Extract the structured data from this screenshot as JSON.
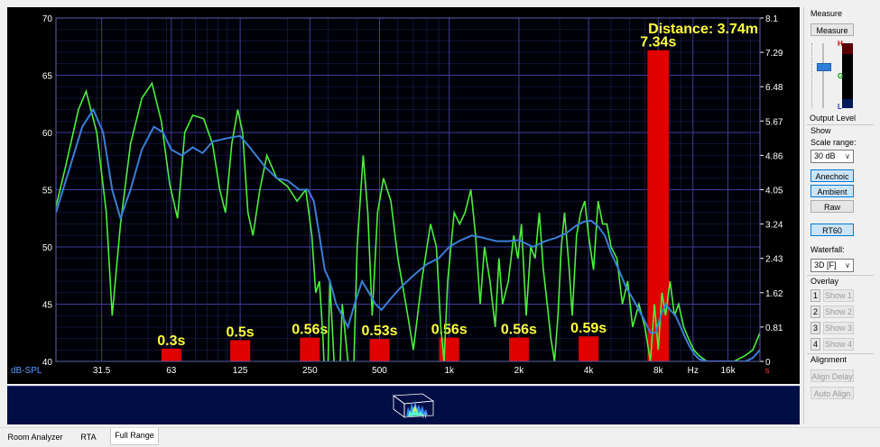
{
  "chart_data": {
    "type": "line",
    "y_axis_label": "dB-SPL",
    "y_left": {
      "min": 40,
      "max": 70,
      "ticks": [
        40,
        45,
        50,
        55,
        60,
        65,
        70
      ]
    },
    "y_right_ticks": [
      "0",
      "0.81",
      "1.62",
      "2.43",
      "3.24",
      "4.05",
      "4.86",
      "5.67",
      "6.48",
      "7.29",
      "8.1"
    ],
    "x_ticks": [
      {
        "label": "31.5",
        "f": 31.5
      },
      {
        "label": "63",
        "f": 63
      },
      {
        "label": "125",
        "f": 125
      },
      {
        "label": "250",
        "f": 250
      },
      {
        "label": "500",
        "f": 500
      },
      {
        "label": "1k",
        "f": 1000
      },
      {
        "label": "2k",
        "f": 2000
      },
      {
        "label": "4k",
        "f": 4000
      },
      {
        "label": "8k",
        "f": 8000
      },
      {
        "label": "Hz",
        "f": 11300
      },
      {
        "label": "16k",
        "f": 16000
      }
    ],
    "x_marker": "s",
    "x_range": [
      20,
      22000
    ],
    "series": [
      {
        "color": "#4cf03c",
        "points": [
          [
            20,
            53.5
          ],
          [
            22,
            57
          ],
          [
            25,
            62
          ],
          [
            27,
            63.6
          ],
          [
            30,
            60
          ],
          [
            33,
            53
          ],
          [
            35,
            44
          ],
          [
            38,
            52
          ],
          [
            42,
            59
          ],
          [
            47,
            63
          ],
          [
            52,
            64.3
          ],
          [
            57,
            61
          ],
          [
            62,
            55.5
          ],
          [
            67,
            52.5
          ],
          [
            72,
            60
          ],
          [
            78,
            61.5
          ],
          [
            87,
            61.2
          ],
          [
            95,
            59
          ],
          [
            102,
            55
          ],
          [
            108,
            53
          ],
          [
            115,
            59
          ],
          [
            122,
            62
          ],
          [
            128,
            60
          ],
          [
            135,
            53
          ],
          [
            142,
            51
          ],
          [
            152,
            55
          ],
          [
            163,
            58
          ],
          [
            180,
            56
          ],
          [
            200,
            55.3
          ],
          [
            220,
            54
          ],
          [
            240,
            55
          ],
          [
            255,
            51
          ],
          [
            265,
            46
          ],
          [
            275,
            47
          ],
          [
            285,
            42
          ],
          [
            295,
            33
          ],
          [
            305,
            47
          ],
          [
            318,
            40
          ],
          [
            330,
            30
          ],
          [
            345,
            45
          ],
          [
            365,
            40
          ],
          [
            380,
            33
          ],
          [
            400,
            50
          ],
          [
            425,
            58
          ],
          [
            445,
            53
          ],
          [
            465,
            44
          ],
          [
            490,
            53
          ],
          [
            520,
            56
          ],
          [
            560,
            54
          ],
          [
            600,
            49
          ],
          [
            650,
            45
          ],
          [
            700,
            41
          ],
          [
            760,
            47
          ],
          [
            830,
            52
          ],
          [
            880,
            50
          ],
          [
            920,
            43
          ],
          [
            950,
            40
          ],
          [
            985,
            47
          ],
          [
            1050,
            53
          ],
          [
            1110,
            52
          ],
          [
            1170,
            53
          ],
          [
            1240,
            55
          ],
          [
            1300,
            51
          ],
          [
            1360,
            45
          ],
          [
            1420,
            50
          ],
          [
            1500,
            47
          ],
          [
            1580,
            43
          ],
          [
            1640,
            49
          ],
          [
            1700,
            45
          ],
          [
            1800,
            47
          ],
          [
            1900,
            51
          ],
          [
            1980,
            49
          ],
          [
            2050,
            52
          ],
          [
            2150,
            44
          ],
          [
            2250,
            50
          ],
          [
            2350,
            49
          ],
          [
            2450,
            53
          ],
          [
            2550,
            48
          ],
          [
            2650,
            45
          ],
          [
            2750,
            42
          ],
          [
            2850,
            40
          ],
          [
            2950,
            44
          ],
          [
            3050,
            50
          ],
          [
            3150,
            53
          ],
          [
            3300,
            48
          ],
          [
            3400,
            44
          ],
          [
            3550,
            51
          ],
          [
            3700,
            53
          ],
          [
            3850,
            54
          ],
          [
            4000,
            51
          ],
          [
            4200,
            48
          ],
          [
            4400,
            54
          ],
          [
            4600,
            52
          ],
          [
            4800,
            52
          ],
          [
            5000,
            50
          ],
          [
            5300,
            49
          ],
          [
            5600,
            45
          ],
          [
            5900,
            47
          ],
          [
            6200,
            43
          ],
          [
            6600,
            45
          ],
          [
            7000,
            43
          ],
          [
            7400,
            40
          ],
          [
            7700,
            45
          ],
          [
            8000,
            41
          ],
          [
            8300,
            46
          ],
          [
            8600,
            44
          ],
          [
            9000,
            47
          ],
          [
            9400,
            44
          ],
          [
            9800,
            45
          ],
          [
            10300,
            43
          ],
          [
            10800,
            42
          ],
          [
            11400,
            41
          ],
          [
            12000,
            40.5
          ],
          [
            13000,
            40
          ],
          [
            15000,
            40
          ],
          [
            17000,
            40
          ],
          [
            19000,
            40.5
          ],
          [
            20500,
            41
          ],
          [
            22000,
            42.5
          ]
        ]
      },
      {
        "color": "#3a7fd8",
        "points": [
          [
            20,
            53
          ],
          [
            23,
            57
          ],
          [
            26,
            60.5
          ],
          [
            29,
            62
          ],
          [
            32,
            60
          ],
          [
            35,
            55
          ],
          [
            38,
            52.5
          ],
          [
            42,
            55
          ],
          [
            47,
            58.5
          ],
          [
            53,
            60.5
          ],
          [
            58,
            60
          ],
          [
            63,
            58.5
          ],
          [
            70,
            58
          ],
          [
            78,
            58.7
          ],
          [
            86,
            58.2
          ],
          [
            95,
            59.2
          ],
          [
            110,
            59.5
          ],
          [
            125,
            59.7
          ],
          [
            140,
            58.5
          ],
          [
            160,
            57
          ],
          [
            180,
            56
          ],
          [
            200,
            55.8
          ],
          [
            225,
            55
          ],
          [
            245,
            55
          ],
          [
            260,
            54
          ],
          [
            275,
            51
          ],
          [
            290,
            48
          ],
          [
            305,
            47
          ],
          [
            325,
            45
          ],
          [
            345,
            44
          ],
          [
            365,
            43
          ],
          [
            390,
            45
          ],
          [
            420,
            47
          ],
          [
            450,
            46
          ],
          [
            480,
            45
          ],
          [
            510,
            44.5
          ],
          [
            560,
            45.5
          ],
          [
            620,
            46.5
          ],
          [
            700,
            47.5
          ],
          [
            800,
            48.5
          ],
          [
            900,
            49
          ],
          [
            1000,
            50
          ],
          [
            1100,
            50.5
          ],
          [
            1250,
            51
          ],
          [
            1400,
            50.8
          ],
          [
            1600,
            50.5
          ],
          [
            1800,
            50.5
          ],
          [
            2000,
            50.6
          ],
          [
            2300,
            50
          ],
          [
            2600,
            50.5
          ],
          [
            2900,
            50.8
          ],
          [
            3200,
            51.2
          ],
          [
            3500,
            51.8
          ],
          [
            3800,
            52.2
          ],
          [
            4100,
            52.3
          ],
          [
            4400,
            51.8
          ],
          [
            4700,
            51
          ],
          [
            5000,
            49.5
          ],
          [
            5400,
            48
          ],
          [
            5800,
            46.5
          ],
          [
            6200,
            45.5
          ],
          [
            6600,
            44.5
          ],
          [
            7000,
            43.5
          ],
          [
            7400,
            42.5
          ],
          [
            7800,
            42.5
          ],
          [
            8200,
            44
          ],
          [
            8600,
            45
          ],
          [
            9000,
            44.5
          ],
          [
            9500,
            44
          ],
          [
            10000,
            43
          ],
          [
            10500,
            42
          ],
          [
            11000,
            41.2
          ],
          [
            11500,
            40.6
          ],
          [
            12000,
            40.2
          ],
          [
            13000,
            40
          ],
          [
            17000,
            40
          ],
          [
            19000,
            40
          ],
          [
            20500,
            40.3
          ],
          [
            22000,
            41
          ]
        ]
      }
    ],
    "rt60_bars": [
      {
        "f": 63,
        "value": 0.3,
        "label": "0.3s"
      },
      {
        "f": 125,
        "value": 0.5,
        "label": "0.5s"
      },
      {
        "f": 250,
        "value": 0.56,
        "label": "0.56s"
      },
      {
        "f": 500,
        "value": 0.53,
        "label": "0.53s"
      },
      {
        "f": 1000,
        "value": 0.56,
        "label": "0.56s"
      },
      {
        "f": 2000,
        "value": 0.56,
        "label": "0.56s"
      },
      {
        "f": 4000,
        "value": 0.59,
        "label": "0.59s"
      },
      {
        "f": 8000,
        "value": 7.34,
        "label": "7.34s"
      }
    ],
    "distance_label": "Distance: 3.74m"
  },
  "panel": {
    "measure_title": "Measure",
    "measure_button": "Measure",
    "meter": {
      "h": "H",
      "g": "G",
      "l": "L"
    },
    "output_level": "Output Level",
    "show": "Show",
    "scale_range": "Scale range:",
    "scale_value": "30 dB",
    "anechoic": "Anechoic",
    "ambient": "Ambient",
    "raw": "Raw",
    "rt60": "RT60",
    "waterfall": "Waterfall:",
    "waterfall_value": "3D [F]",
    "overlay": "Overlay",
    "overlays": [
      {
        "num": "1",
        "label": "Show 1"
      },
      {
        "num": "2",
        "label": "Show 2"
      },
      {
        "num": "3",
        "label": "Show 3"
      },
      {
        "num": "4",
        "label": "Show 4"
      }
    ],
    "alignment": "Alignment",
    "align_delay": "Align Delay",
    "auto_align": "Auto Align"
  },
  "tabs": [
    "Room Analyzer",
    "RTA",
    "Full Range"
  ]
}
